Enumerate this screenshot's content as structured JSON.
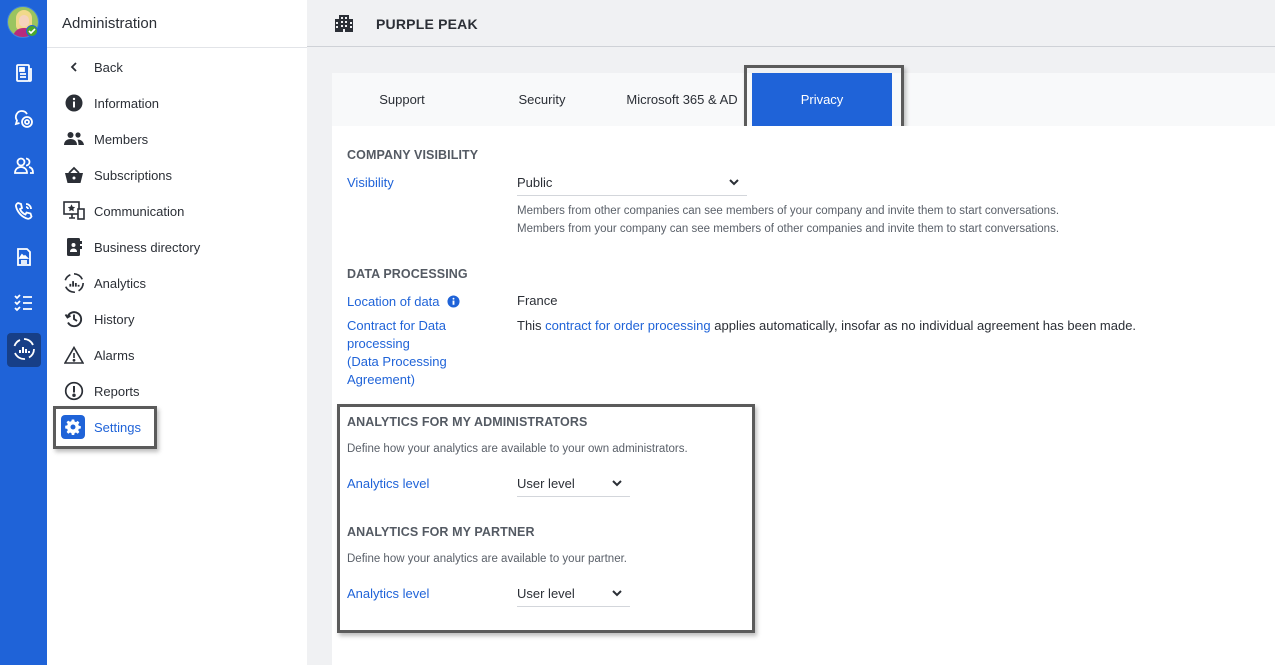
{
  "rail": {
    "items": [
      {
        "icon": "newspaper-icon"
      },
      {
        "icon": "chat-bubbles-icon"
      },
      {
        "icon": "contacts-icon"
      },
      {
        "icon": "phone-call-icon"
      },
      {
        "icon": "document-image-icon"
      },
      {
        "icon": "checklist-icon"
      },
      {
        "icon": "analytics-icon",
        "active": true
      }
    ]
  },
  "sidebar": {
    "title": "Administration",
    "items": [
      {
        "label": "Back",
        "icon": "chevron-left-icon"
      },
      {
        "label": "Information",
        "icon": "info-icon"
      },
      {
        "label": "Members",
        "icon": "members-icon"
      },
      {
        "label": "Subscriptions",
        "icon": "basket-icon"
      },
      {
        "label": "Communication",
        "icon": "communication-icon"
      },
      {
        "label": "Business directory",
        "icon": "directory-icon"
      },
      {
        "label": "Analytics",
        "icon": "analytics-icon"
      },
      {
        "label": "History",
        "icon": "history-icon"
      },
      {
        "label": "Alarms",
        "icon": "warning-icon"
      },
      {
        "label": "Reports",
        "icon": "report-icon"
      },
      {
        "label": "Settings",
        "icon": "gear-icon",
        "active": true
      }
    ]
  },
  "header": {
    "company_name": "PURPLE PEAK",
    "icon": "building-icon"
  },
  "tabs": [
    {
      "label": "Support"
    },
    {
      "label": "Security"
    },
    {
      "label": "Microsoft 365 & AD"
    },
    {
      "label": "Privacy",
      "active": true
    }
  ],
  "company_visibility": {
    "title": "COMPANY VISIBILITY",
    "visibility_label": "Visibility",
    "visibility_value": "Public",
    "help_lines": [
      "Members from other companies can see members of your company and invite them to start conversations.",
      "Members from your company can see members of other companies and invite them to start conversations."
    ]
  },
  "data_processing": {
    "title": "DATA PROCESSING",
    "location_label": "Location of data",
    "location_value": "France",
    "contract_label": "Contract for Data processing (Data Processing Agreement)",
    "contract_label_lines": [
      "Contract for Data",
      "processing",
      "(Data Processing",
      "Agreement)"
    ],
    "contract_prefix": "This ",
    "contract_link": "contract for order processing",
    "contract_suffix": " applies automatically, insofar as no individual agreement has been made."
  },
  "analytics_admins": {
    "title": "ANALYTICS FOR MY ADMINISTRATORS",
    "description": "Define how your analytics are available to your own administrators.",
    "level_label": "Analytics level",
    "level_value": "User level"
  },
  "analytics_partner": {
    "title": "ANALYTICS FOR MY PARTNER",
    "description": "Define how your analytics are available to your partner.",
    "level_label": "Analytics level",
    "level_value": "User level"
  },
  "colors": {
    "brand_blue": "#1f63d8",
    "rail_active": "#173f87",
    "highlight_border": "#5b5b5b"
  }
}
